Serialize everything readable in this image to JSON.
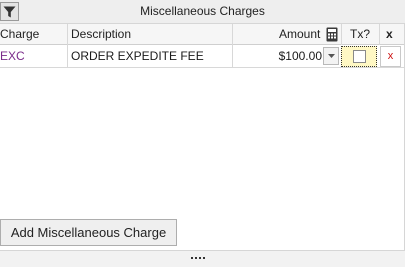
{
  "panel": {
    "title": "Miscellaneous Charges",
    "filter_icon": "filter-icon"
  },
  "columns": {
    "charge": "Charge",
    "description": "Description",
    "amount": "Amount",
    "calculator_icon": "calculator-icon",
    "tx": "Tx?",
    "delete_header": "x"
  },
  "rows": [
    {
      "charge": "EXC",
      "description": "ORDER  EXPEDITE FEE",
      "amount": "$100.00",
      "taxable": false,
      "delete_label": "x"
    }
  ],
  "actions": {
    "add_label": "Add Miscellaneous Charge"
  },
  "colors": {
    "charge_code": "#7a2a8a",
    "tx_highlight": "#fff8c4",
    "delete_red": "#cc1111"
  }
}
